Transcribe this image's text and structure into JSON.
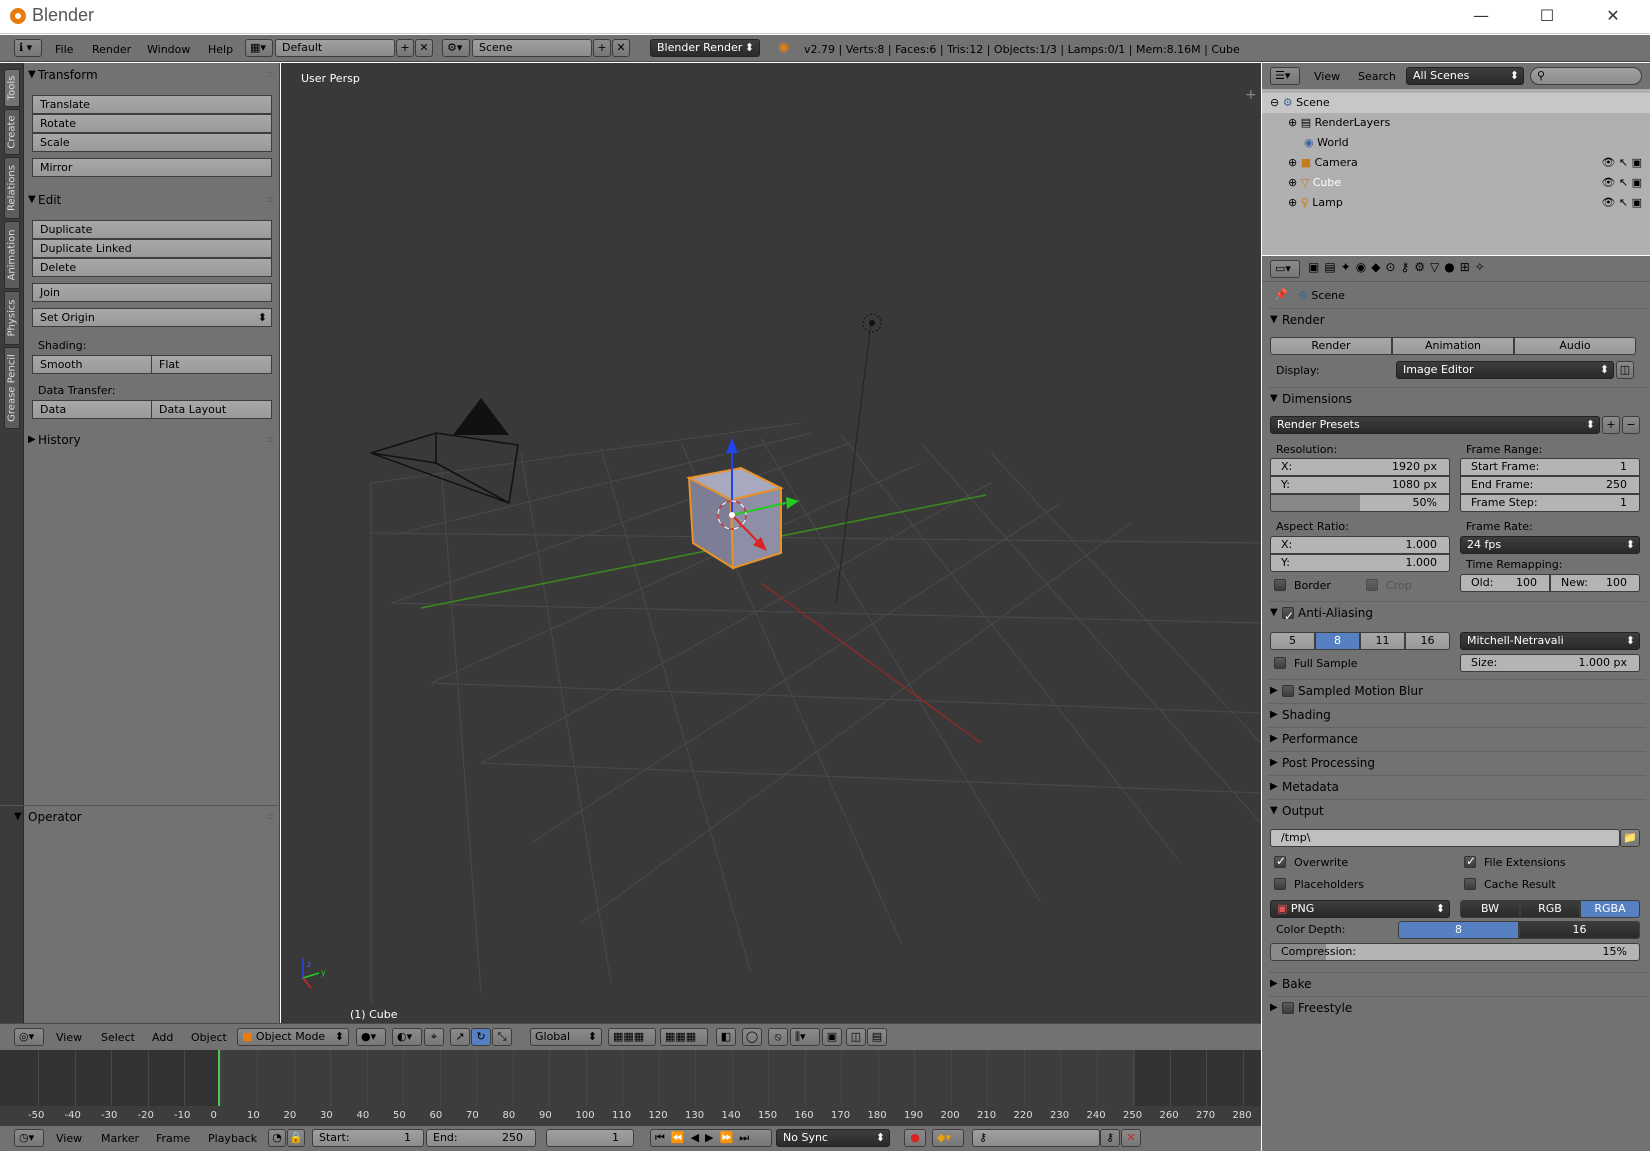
{
  "window": {
    "title": "Blender",
    "minimize": "—",
    "maximize": "☐",
    "close": "✕"
  },
  "info_header": {
    "menus": [
      "File",
      "Render",
      "Window",
      "Help"
    ],
    "screen_layout": "Default",
    "scene": "Scene",
    "engine": "Blender Render",
    "stats": "v2.79 | Verts:8 | Faces:6 | Tris:12 | Objects:1/3 | Lamps:0/1 | Mem:8.16M | Cube"
  },
  "tool_tabs": [
    "Tools",
    "Create",
    "Relations",
    "Animation",
    "Physics",
    "Grease Pencil"
  ],
  "tool_shelf": {
    "transform": {
      "title": "Transform",
      "buttons": [
        "Translate",
        "Rotate",
        "Scale",
        "Mirror"
      ]
    },
    "edit": {
      "title": "Edit",
      "buttons": [
        "Duplicate",
        "Duplicate Linked",
        "Delete",
        "Join"
      ],
      "set_origin": "Set Origin",
      "shading_label": "Shading:",
      "smooth": "Smooth",
      "flat": "Flat",
      "data_transfer_label": "Data Transfer:",
      "data": "Data",
      "data_layout": "Data Layout"
    },
    "history": "History",
    "operator": "Operator"
  },
  "viewport": {
    "view_name": "User Persp",
    "object_label": "(1) Cube",
    "axis_z": "z",
    "axis_y": "y"
  },
  "viewport_header": {
    "menus": [
      "View",
      "Select",
      "Add",
      "Object"
    ],
    "mode": "Object Mode",
    "orientation": "Global"
  },
  "timeline": {
    "ticks": [
      "-50",
      "-40",
      "-30",
      "-20",
      "-10",
      "0",
      "10",
      "20",
      "30",
      "40",
      "50",
      "60",
      "70",
      "80",
      "90",
      "100",
      "110",
      "120",
      "130",
      "140",
      "150",
      "160",
      "170",
      "180",
      "190",
      "200",
      "210",
      "220",
      "230",
      "240",
      "250",
      "260",
      "270",
      "280"
    ],
    "menus": [
      "View",
      "Marker",
      "Frame",
      "Playback"
    ],
    "start_label": "Start:",
    "start": "1",
    "end_label": "End:",
    "end": "250",
    "current": "1",
    "sync": "No Sync"
  },
  "outliner": {
    "menus": [
      "View",
      "Search"
    ],
    "filter": "All Scenes",
    "items": [
      "Scene",
      "RenderLayers",
      "World",
      "Camera",
      "Cube",
      "Lamp"
    ]
  },
  "properties": {
    "context": "Scene",
    "render": {
      "title": "Render",
      "render_btn": "Render",
      "animation_btn": "Animation",
      "audio_btn": "Audio",
      "display_label": "Display:",
      "display": "Image Editor"
    },
    "dimensions": {
      "title": "Dimensions",
      "presets": "Render Presets",
      "resolution_label": "Resolution:",
      "res_x_label": "X:",
      "res_x": "1920 px",
      "res_y_label": "Y:",
      "res_y": "1080 px",
      "res_pct": "50%",
      "frame_range_label": "Frame Range:",
      "start_label": "Start Frame:",
      "start": "1",
      "end_label": "End Frame:",
      "end": "250",
      "step_label": "Frame Step:",
      "step": "1",
      "aspect_label": "Aspect Ratio:",
      "asp_x_label": "X:",
      "asp_x": "1.000",
      "asp_y_label": "Y:",
      "asp_y": "1.000",
      "frame_rate_label": "Frame Rate:",
      "fps": "24 fps",
      "time_remap_label": "Time Remapping:",
      "old_label": "Old:",
      "old": "100",
      "new_label": "New:",
      "new": "100",
      "border": "Border",
      "crop": "Crop"
    },
    "aa": {
      "title": "Anti-Aliasing",
      "samples": [
        "5",
        "8",
        "11",
        "16"
      ],
      "filter": "Mitchell-Netravali",
      "full_sample": "Full Sample",
      "size_label": "Size:",
      "size": "1.000 px"
    },
    "collapsed": [
      "Sampled Motion Blur",
      "Shading",
      "Performance",
      "Post Processing",
      "Metadata"
    ],
    "output": {
      "title": "Output",
      "path": "/tmp\\",
      "overwrite": "Overwrite",
      "file_ext": "File Extensions",
      "placeholders": "Placeholders",
      "cache": "Cache Result",
      "format": "PNG",
      "bw": "BW",
      "rgb": "RGB",
      "rgba": "RGBA",
      "depth_label": "Color Depth:",
      "depth8": "8",
      "depth16": "16",
      "compression_label": "Compression:",
      "compression": "15%"
    },
    "bake": "Bake",
    "freestyle": "Freestyle"
  }
}
